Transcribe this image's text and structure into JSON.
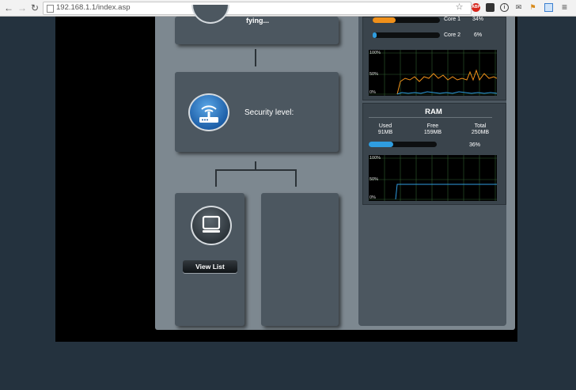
{
  "browser": {
    "back_icon": "arrow-left-icon",
    "forward_icon": "arrow-right-icon",
    "reload_icon": "reload-icon",
    "url": "192.168.1.1/index.asp",
    "extensions": [
      "star-icon",
      "abp-icon",
      "ext-icon",
      "info-icon",
      "mail-icon",
      "flag-icon",
      "capture-icon",
      "menu-icon"
    ]
  },
  "map": {
    "top_node_title": "fying...",
    "router": {
      "label": "Security level:"
    },
    "clients": {
      "button_label": "View List"
    }
  },
  "cpu": {
    "cores": [
      {
        "label": "Core 1",
        "percent": "34%",
        "fill": 0.34,
        "color": "#f0901a"
      },
      {
        "label": "Core 2",
        "percent": "6%",
        "fill": 0.06,
        "color": "#2f9de0"
      }
    ],
    "graph_ticks": [
      "100%",
      "50%",
      "0%"
    ]
  },
  "ram": {
    "title": "RAM",
    "used_label": "Used",
    "used_value": "91MB",
    "free_label": "Free",
    "free_value": "159MB",
    "total_label": "Total",
    "total_value": "250MB",
    "percent": "36%",
    "fill": 0.36,
    "graph_ticks": [
      "100%",
      "50%",
      "0%"
    ]
  }
}
